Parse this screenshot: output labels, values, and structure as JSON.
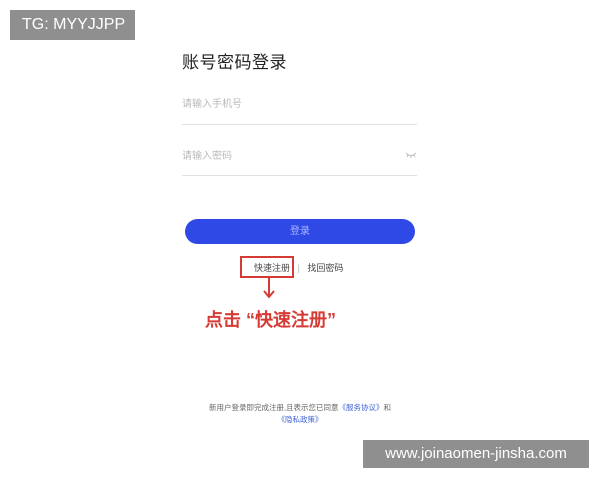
{
  "watermark": {
    "top_left": "TG: MYYJJPP",
    "bottom_right": "www.joinaomen-jinsha.com"
  },
  "login": {
    "title": "账号密码登录",
    "phone_placeholder": "请输入手机号",
    "password_placeholder": "请输入密码",
    "button_label": "登录"
  },
  "links": {
    "register": "快速注册",
    "separator": "|",
    "forgot_password": "找回密码"
  },
  "annotation": {
    "instruction": "点击 “快速注册”",
    "color": "#d53b35"
  },
  "footer": {
    "line1_text": "新用户登录即完成注册,且表示您已同意",
    "service_agreement": "《服务协议》",
    "and": "和",
    "privacy_policy": "《隐私政策》"
  },
  "colors": {
    "primary": "#2f49e6",
    "link": "#4464d6"
  }
}
